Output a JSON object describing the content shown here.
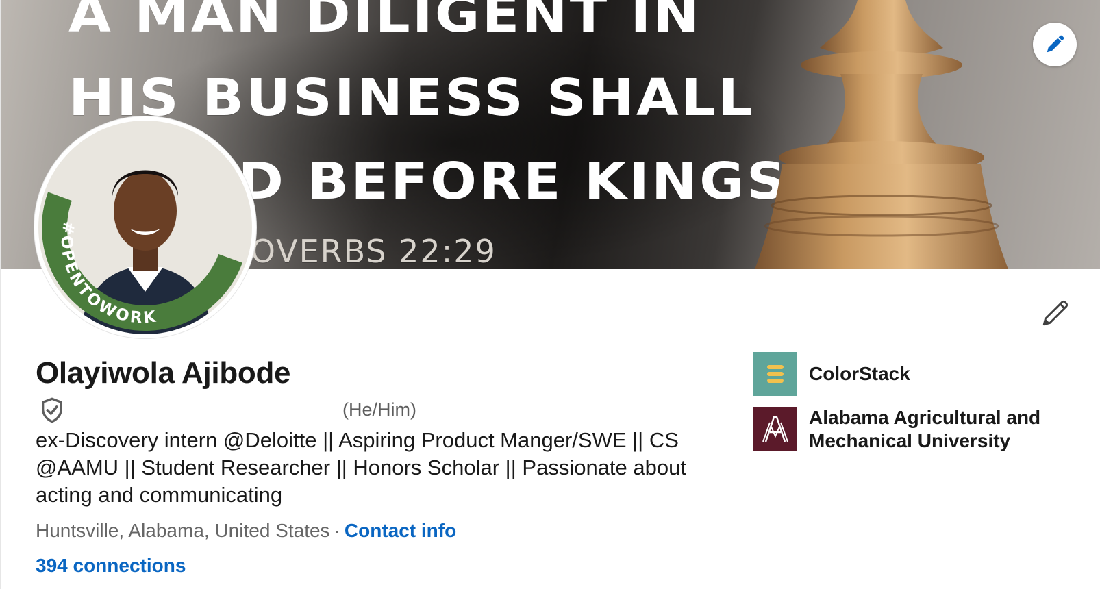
{
  "banner": {
    "lines": [
      "A MAN DILIGENT IN",
      "HIS BUSINESS SHALL",
      "STAND BEFORE KINGS",
      "PROVERBS 22:29"
    ]
  },
  "avatar": {
    "badge_text": "#OPENTOWORK",
    "badge_color": "#4a7c3c"
  },
  "profile": {
    "name": "Olayiwola Ajibode",
    "pronouns": "(He/Him)",
    "headline": "ex-Discovery intern @Deloitte || Aspiring Product Manger/SWE || CS @AAMU || Student Researcher || Honors Scholar || Passionate about acting and communicating",
    "location": "Huntsville, Alabama, United States",
    "separator": "·",
    "contact_info": "Contact info",
    "connections": "394 connections"
  },
  "organizations": [
    {
      "name": "ColorStack",
      "logo_color": "#5fa59a"
    },
    {
      "name": "Alabama Agricultural and Mechanical University",
      "logo_color": "#5b1a2a"
    }
  ],
  "colors": {
    "link": "#0a66c2",
    "text": "#191919",
    "muted": "#666666"
  },
  "icons": {
    "banner_edit": "pencil-icon",
    "profile_edit": "pencil-icon",
    "verification": "shield-check-icon"
  }
}
